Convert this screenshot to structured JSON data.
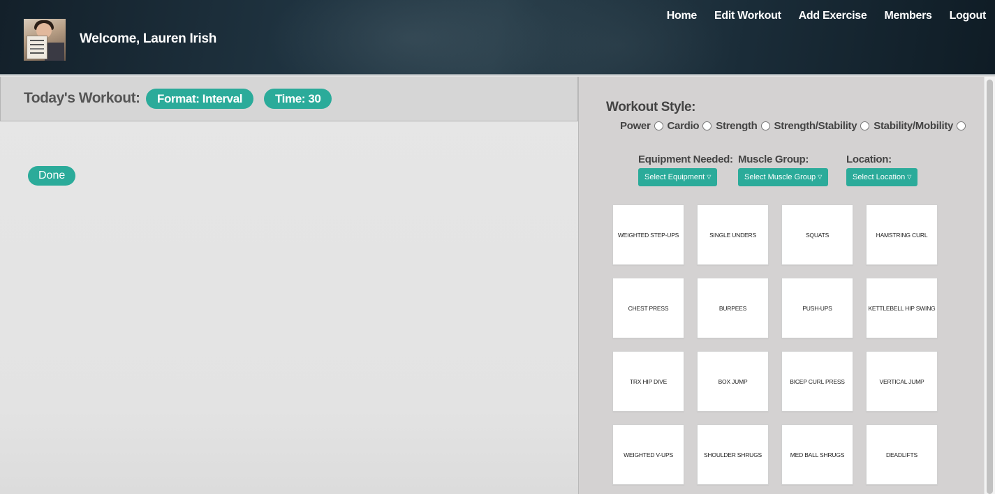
{
  "header": {
    "welcome": "Welcome, Lauren Irish",
    "nav": [
      "Home",
      "Edit Workout",
      "Add Exercise",
      "Members",
      "Logout"
    ]
  },
  "workout": {
    "title": "Today's Workout:",
    "format": "Format: Interval",
    "time": "Time: 30",
    "done_label": "Done"
  },
  "filters": {
    "style_title": "Workout Style:",
    "styles": [
      "Power",
      "Cardio",
      "Strength",
      "Strength/Stability",
      "Stability/Mobility"
    ],
    "equipment_label": "Equipment Needed:",
    "equipment_select": "Select Equipment",
    "muscle_label": "Muscle Group:",
    "muscle_select": "Select Muscle Group",
    "location_label": "Location:",
    "location_select": "Select Location"
  },
  "exercises": [
    "WEIGHTED STEP-UPS",
    "SINGLE UNDERS",
    "SQUATS",
    "HAMSTRING CURL",
    "CHEST PRESS",
    "BURPEES",
    "PUSH-UPS",
    "KETTLEBELL HIP SWING",
    "TRX HIP DIVE",
    "BOX JUMP",
    "BICEP CURL PRESS",
    "VERTICAL JUMP",
    "WEIGHTED V-UPS",
    "SHOULDER SHRUGS",
    "MED BALL SHRUGS",
    "DEADLIFTS"
  ],
  "colors": {
    "accent": "#2bab9a",
    "header_bg": "#1f3340"
  }
}
